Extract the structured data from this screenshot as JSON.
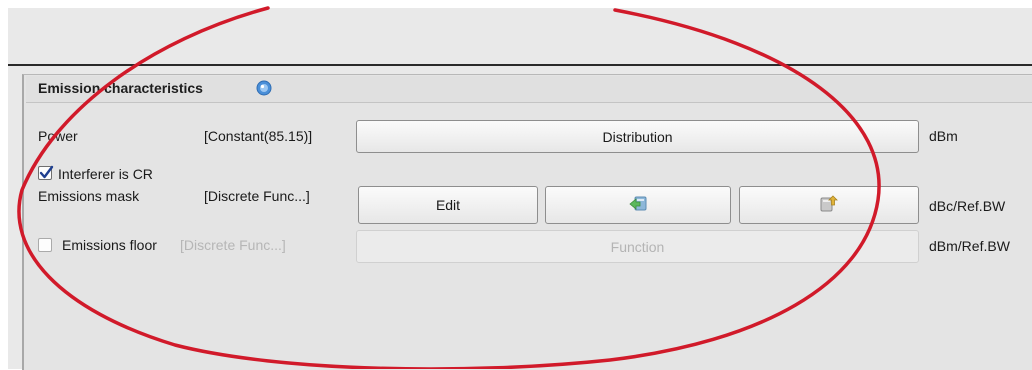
{
  "panel": {
    "title": "Emission characteristics"
  },
  "power": {
    "label": "Power",
    "value": "[Constant(85.15)]",
    "button_label": "Distribution",
    "unit": "dBm"
  },
  "interferer": {
    "label": "Interferer is CR",
    "checked": true
  },
  "emissions_mask": {
    "label": "Emissions mask",
    "value": "[Discrete Func...]",
    "edit_label": "Edit",
    "unit": "dBc/Ref.BW"
  },
  "emissions_floor": {
    "label": "Emissions floor",
    "value": "[Discrete Func...]",
    "button_label": "Function",
    "unit": "dBm/Ref.BW",
    "checked": false,
    "enabled": false
  },
  "icons": {
    "help": "help-icon",
    "export": "export-icon",
    "import": "import-icon"
  },
  "colors": {
    "annotation": "#d11a2a",
    "help_icon": "#4a8fd8",
    "disabled_text": "#b6b6b6"
  }
}
